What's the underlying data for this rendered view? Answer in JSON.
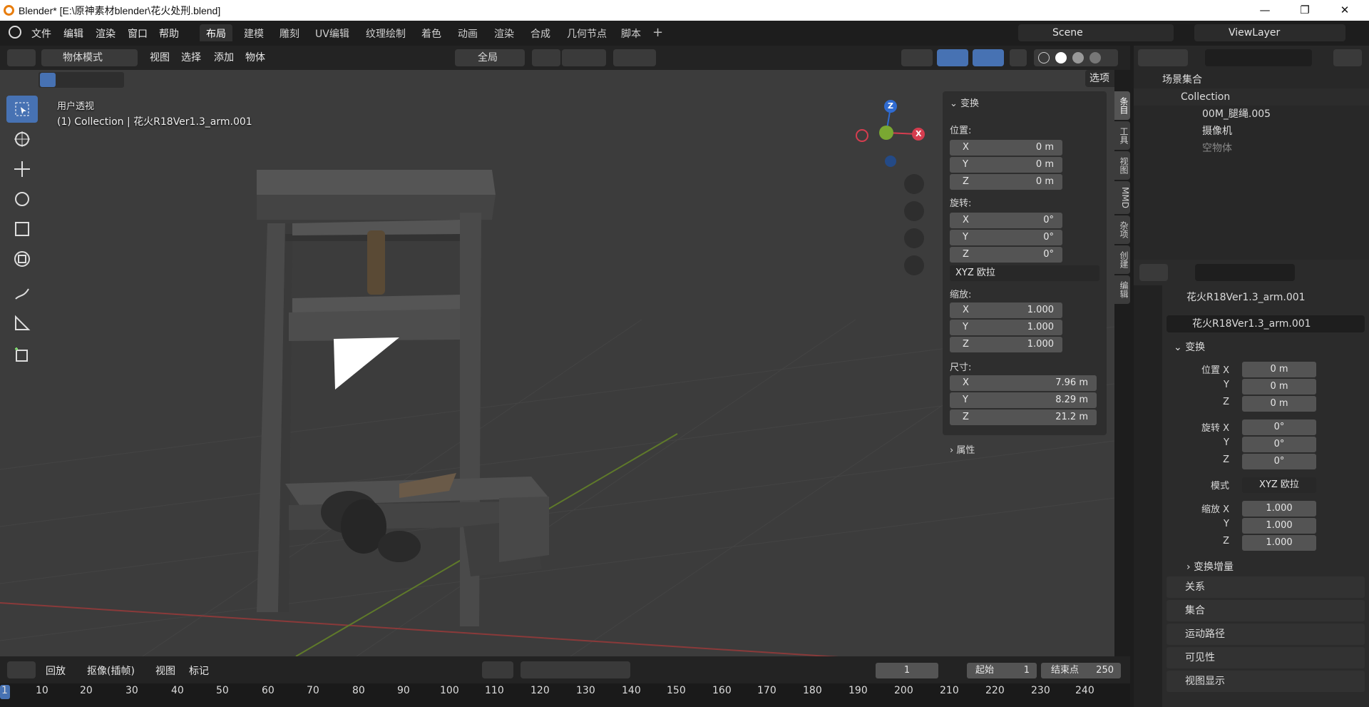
{
  "window": {
    "title": "Blender* [E:\\原神素材blender\\花火处刑.blend]"
  },
  "menu": [
    "文件",
    "编辑",
    "渲染",
    "窗口",
    "帮助"
  ],
  "workspaces": [
    "布局",
    "建模",
    "雕刻",
    "UV编辑",
    "纹理绘制",
    "着色",
    "动画",
    "渲染",
    "合成",
    "几何节点",
    "脚本"
  ],
  "workspace_active": "布局",
  "scene": {
    "name": "Scene"
  },
  "viewlayer": {
    "name": "ViewLayer"
  },
  "viewport_header": {
    "mode": "物体模式",
    "menus": [
      "视图",
      "选择",
      "添加",
      "物体"
    ],
    "transform_orientation": "全局"
  },
  "options_label": "选项",
  "viewport_overlay": {
    "line1": "用户透视",
    "line2": "(1) Collection | 花火R18Ver1.3_arm.001"
  },
  "gizmo": {
    "z": "Z",
    "x": "X"
  },
  "npanel": {
    "transform_title": "变换",
    "location_label": "位置:",
    "location": [
      {
        "axis": "X",
        "value": "0 m"
      },
      {
        "axis": "Y",
        "value": "0 m"
      },
      {
        "axis": "Z",
        "value": "0 m"
      }
    ],
    "rotation_label": "旋转:",
    "rotation": [
      {
        "axis": "X",
        "value": "0°"
      },
      {
        "axis": "Y",
        "value": "0°"
      },
      {
        "axis": "Z",
        "value": "0°"
      }
    ],
    "rotation_mode": "XYZ 欧拉",
    "scale_label": "缩放:",
    "scale": [
      {
        "axis": "X",
        "value": "1.000"
      },
      {
        "axis": "Y",
        "value": "1.000"
      },
      {
        "axis": "Z",
        "value": "1.000"
      }
    ],
    "dimensions_label": "尺寸:",
    "dimensions": [
      {
        "axis": "X",
        "value": "7.96 m"
      },
      {
        "axis": "Y",
        "value": "8.29 m"
      },
      {
        "axis": "Z",
        "value": "21.2 m"
      }
    ],
    "properties_title": "属性"
  },
  "npanel_tabs": [
    "条目",
    "工具",
    "视图",
    "MMD",
    "杂项",
    "创建",
    "编辑"
  ],
  "outliner": {
    "root": "场景集合",
    "collection": "Collection",
    "items": [
      {
        "name": "00M_腿绳.005"
      },
      {
        "name": "摄像机"
      },
      {
        "name": "空物体"
      }
    ]
  },
  "props": {
    "object_name": "花火R18Ver1.3_arm.001",
    "object_name_field": "花火R18Ver1.3_arm.001",
    "transform_title": "变换",
    "location_label": "位置 X",
    "loc": [
      "0 m",
      "0 m",
      "0 m"
    ],
    "rotation_label": "旋转 X",
    "rot": [
      "0°",
      "0°",
      "0°"
    ],
    "mode_label": "模式",
    "mode_value": "XYZ 欧拉",
    "scale_label": "缩放 X",
    "scale": [
      "1.000",
      "1.000",
      "1.000"
    ],
    "y": "Y",
    "z": "Z",
    "delta": "变换增量",
    "sections": [
      "关系",
      "集合",
      "运动路径",
      "可见性",
      "视图显示"
    ]
  },
  "timeline": {
    "playback": "回放",
    "keying": "抠像(插帧)",
    "view": "视图",
    "marker": "标记",
    "current_frame": "1",
    "start_label": "起始",
    "start": "1",
    "end_label": "结束点",
    "end": "250",
    "ticks": [
      "1",
      "10",
      "20",
      "30",
      "40",
      "50",
      "60",
      "70",
      "80",
      "90",
      "100",
      "110",
      "120",
      "130",
      "140",
      "150",
      "160",
      "170",
      "180",
      "190",
      "200",
      "210",
      "220",
      "230",
      "240"
    ]
  }
}
